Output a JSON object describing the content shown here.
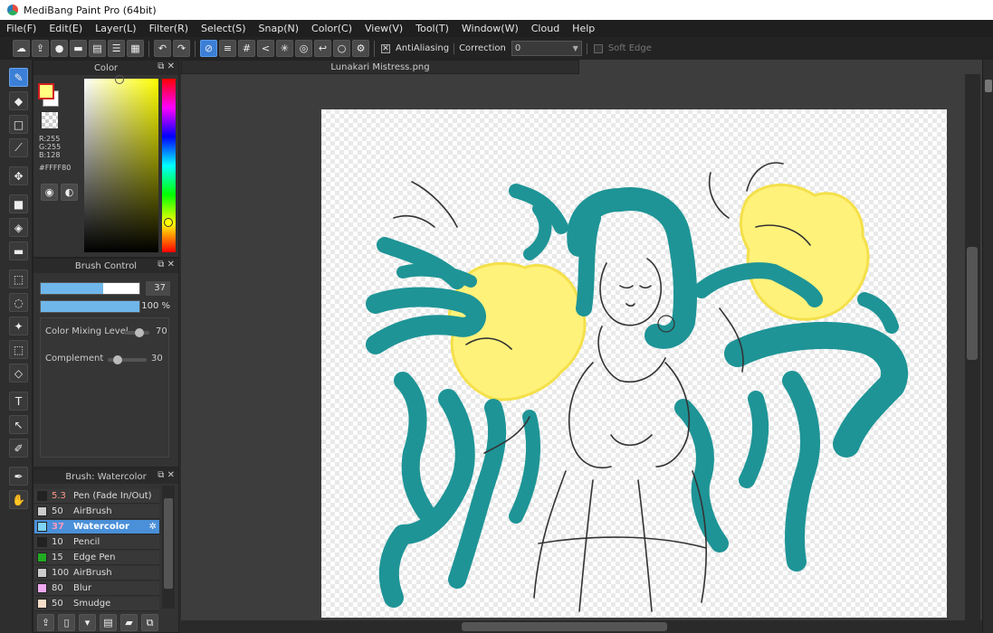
{
  "window": {
    "title": "MediBang Paint Pro (64bit)"
  },
  "menu": [
    "File(F)",
    "Edit(E)",
    "Layer(L)",
    "Filter(R)",
    "Select(S)",
    "Snap(N)",
    "Color(C)",
    "View(V)",
    "Tool(T)",
    "Window(W)",
    "Cloud",
    "Help"
  ],
  "toolbar": {
    "antialiasing_label": "AntiAliasing",
    "correction_label": "Correction",
    "correction_value": "0",
    "soft_edge_label": "Soft Edge"
  },
  "color_panel": {
    "title": "Color",
    "r": "R:255",
    "g": "G:255",
    "b": "B:128",
    "hex": "#FFFF80",
    "fg_color": "#FFFF80",
    "bg_color": "#FFFFFF"
  },
  "brush_control": {
    "title": "Brush Control",
    "size_value": "37",
    "opacity_value": "100 %",
    "color_mixing_label": "Color Mixing Level",
    "color_mixing_value": "70",
    "complement_label": "Complement",
    "complement_value": "30"
  },
  "brush_list": {
    "title": "Brush: Watercolor",
    "items": [
      {
        "size": "5.3",
        "name": "Pen (Fade In/Out)",
        "swatch": "#222222"
      },
      {
        "size": "50",
        "name": "AirBrush",
        "swatch": "#cccccc"
      },
      {
        "size": "37",
        "name": "Watercolor",
        "swatch": "#7fd3f7",
        "selected": true
      },
      {
        "size": "10",
        "name": "Pencil",
        "swatch": "#222222"
      },
      {
        "size": "15",
        "name": "Edge Pen",
        "swatch": "#22aa22"
      },
      {
        "size": "100",
        "name": "AirBrush",
        "swatch": "#cccccc"
      },
      {
        "size": "80",
        "name": "Blur",
        "swatch": "#f0a8f0"
      },
      {
        "size": "50",
        "name": "Smudge",
        "swatch": "#f7dcc8"
      }
    ]
  },
  "document": {
    "tab_title": "Lunakari Mistress.png"
  },
  "colors": {
    "teal": "#1e9496",
    "yellow": "#fff27a",
    "accent": "#3b7fd6"
  }
}
